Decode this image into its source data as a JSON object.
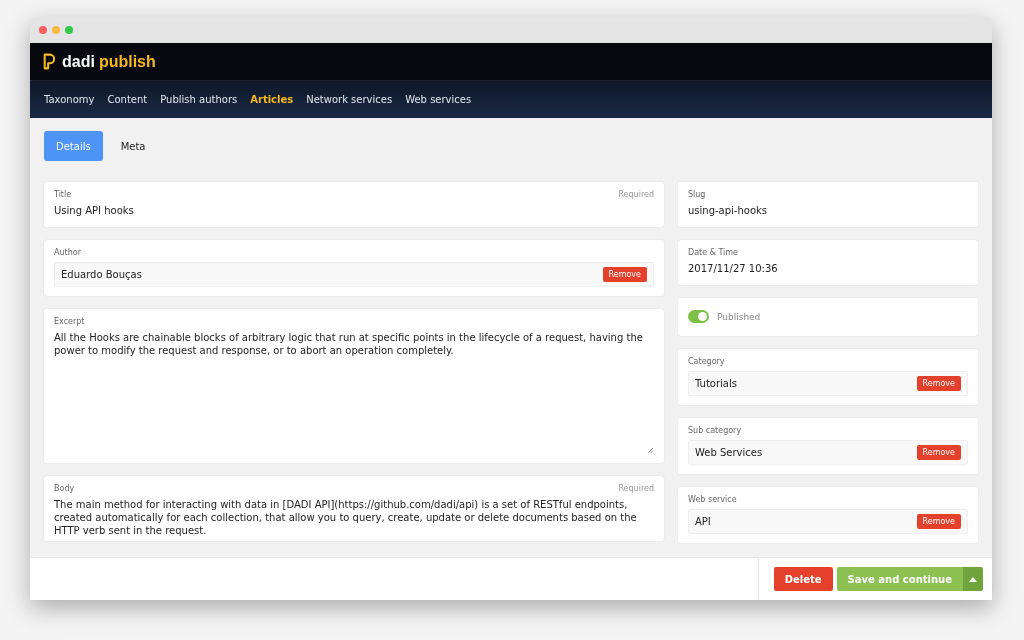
{
  "brand": {
    "name_part_1": "dadi",
    "name_part_2": "publish"
  },
  "nav": [
    {
      "label": "Taxonomy",
      "selected": false
    },
    {
      "label": "Content",
      "selected": false
    },
    {
      "label": "Publish authors",
      "selected": false
    },
    {
      "label": "Articles",
      "selected": true
    },
    {
      "label": "Network services",
      "selected": false
    },
    {
      "label": "Web services",
      "selected": false
    }
  ],
  "tabs": [
    {
      "label": "Details",
      "selected": true
    },
    {
      "label": "Meta",
      "selected": false
    }
  ],
  "main_fields": [
    {
      "kind": "text",
      "label": "Title",
      "note": "Required",
      "value": "Using API hooks"
    },
    {
      "kind": "reference",
      "label": "Author",
      "value": "Eduardo Bouças",
      "action": "Remove"
    },
    {
      "kind": "textarea",
      "label": "Excerpt",
      "value": "All the Hooks are chainable blocks of arbitrary logic that run at specific points in the lifecycle of a request, having the power to modify the request and response, or to abort an operation completely."
    },
    {
      "kind": "body",
      "label": "Body",
      "note": "Required",
      "value": "The main method for interacting with data in [DADI API](https://github.com/dadi/api) is a set of RESTful endpoints, created automatically for each collection, that allow you to query, create, update or delete documents based on the HTTP verb sent in the request."
    }
  ],
  "side_fields": [
    {
      "kind": "text",
      "label": "Slug",
      "value": "using-api-hooks"
    },
    {
      "kind": "text",
      "label": "Date & Time",
      "value": "2017/11/27 10:36"
    },
    {
      "kind": "toggle",
      "label": "Published",
      "on": true
    },
    {
      "kind": "reference",
      "label": "Category",
      "value": "Tutorials",
      "action": "Remove"
    },
    {
      "kind": "reference",
      "label": "Sub category",
      "value": "Web Services",
      "action": "Remove"
    },
    {
      "kind": "reference",
      "label": "Web service",
      "value": "API",
      "action": "Remove"
    }
  ],
  "footer": {
    "delete": "Delete",
    "save": "Save and continue"
  }
}
